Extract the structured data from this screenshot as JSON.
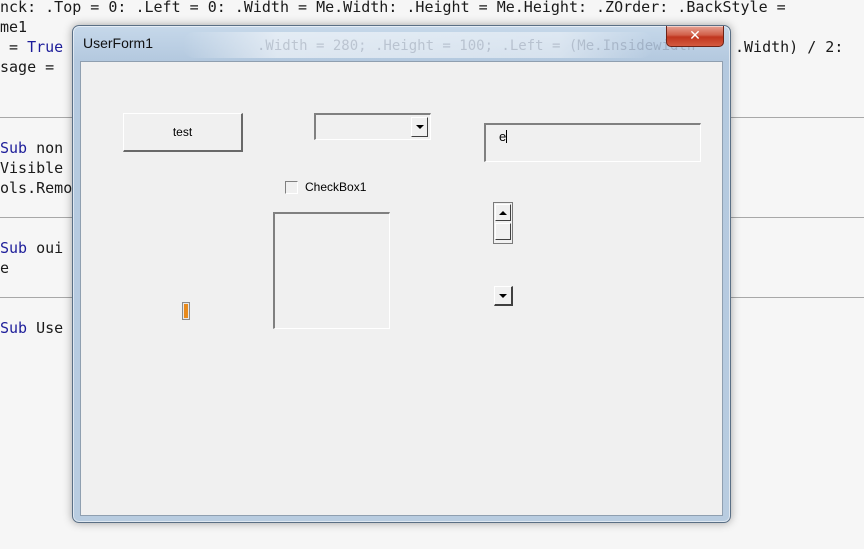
{
  "background_code": {
    "lines": [
      {
        "prefix": "",
        "text": "nck: .Top = 0: .Left = 0: .Width = Me.Width: .Height = Me.Height: .ZOrder: .BackStyle ="
      },
      {
        "prefix": "",
        "text": "me1"
      },
      {
        "prefix": " = ",
        "kw": "True",
        "text": "",
        "tail": ".Width) / 2:"
      },
      {
        "prefix": "",
        "text": "sage ="
      },
      {
        "prefix": "",
        "kw": "Sub",
        "text": " non"
      },
      {
        "prefix": "",
        "text": "Visible ="
      },
      {
        "prefix": "",
        "text": "ols.Remo"
      },
      {
        "prefix": "",
        "kw": "Sub",
        "text": " oui"
      },
      {
        "prefix": "",
        "text": "e"
      },
      {
        "prefix": "",
        "kw": "Sub",
        "text": " Use"
      }
    ],
    "ghost_title_text": ".Width = 280; .Height = 100; .Left = (Me.Insidewidth"
  },
  "window": {
    "title": "UserForm1",
    "close_glyph": "✕"
  },
  "controls": {
    "command_button_label": "test",
    "combo_value": "",
    "textbox_value": "e",
    "checkbox_label": "CheckBox1",
    "checkbox_checked": false
  },
  "colors": {
    "keyword": "#1d1d9a",
    "close_button": "#c0361f",
    "indicator": "#e88a1c"
  }
}
